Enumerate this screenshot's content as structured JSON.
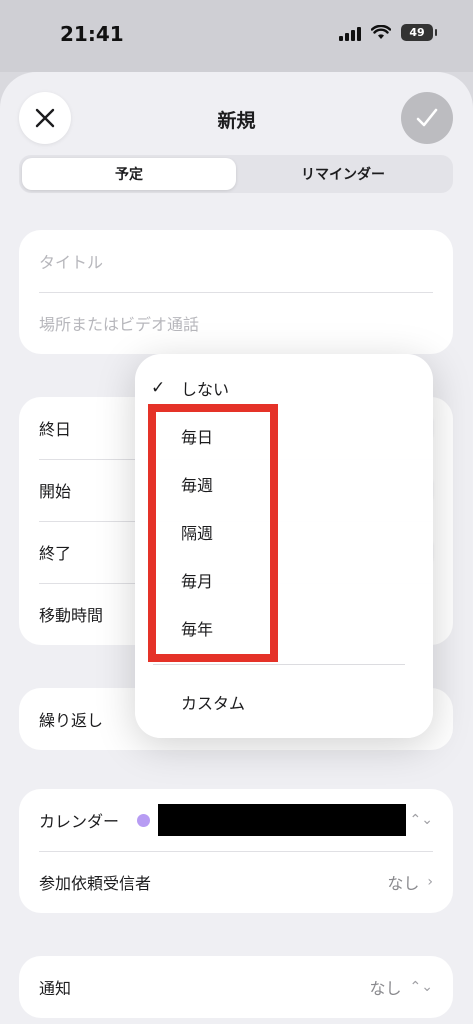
{
  "status_bar": {
    "time": "21:41",
    "battery": "49"
  },
  "header": {
    "title": "新規"
  },
  "segments": [
    {
      "label": "予定",
      "active": true
    },
    {
      "label": "リマインダー",
      "active": false
    }
  ],
  "event_fields": {
    "title_placeholder": "タイトル",
    "location_placeholder": "場所またはビデオ通話"
  },
  "time_rows": [
    {
      "label": "終日"
    },
    {
      "label": "開始"
    },
    {
      "label": "終了"
    },
    {
      "label": "移動時間"
    }
  ],
  "repeat_row": {
    "label": "繰り返し"
  },
  "repeat_menu": {
    "items": [
      {
        "label": "しない",
        "checked": true
      },
      {
        "label": "毎日"
      },
      {
        "label": "毎週"
      },
      {
        "label": "隔週"
      },
      {
        "label": "毎月"
      },
      {
        "label": "毎年"
      }
    ],
    "custom": "カスタム",
    "highlight_color": "#e53228"
  },
  "calendar_card": {
    "calendar_label": "カレンダー",
    "calendar_color": "#b79cf3",
    "invitees_label": "参加依頼受信者",
    "invitees_value": "なし"
  },
  "alert_card": {
    "label": "通知",
    "value": "なし"
  }
}
